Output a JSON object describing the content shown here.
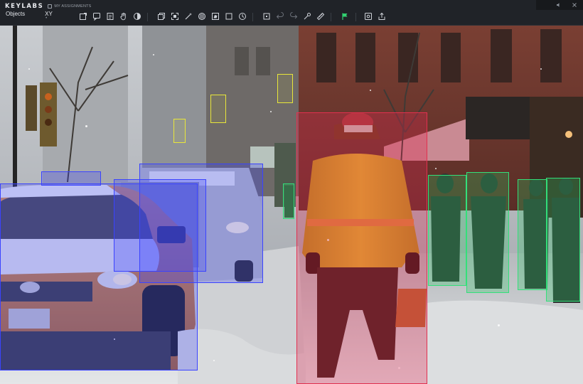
{
  "app": {
    "logo": "KEYLABS",
    "breadcrumb": "MY ASSIGNMENTS"
  },
  "panel_tabs": [
    {
      "label": "Objects"
    },
    {
      "label": "XY"
    }
  ],
  "toolbar": {
    "tools": [
      "frame-icon",
      "comment-icon",
      "document-icon",
      "hand-icon",
      "contrast-icon",
      "copy-layer-icon",
      "expand-icon",
      "magic-icon",
      "pattern-icon",
      "polygon-icon",
      "square-icon",
      "clock-icon",
      "bounding-box-icon",
      "undo-icon",
      "redo-icon",
      "smart-tool-icon",
      "ruler-icon",
      "flag-icon",
      "settings-icon",
      "export-icon"
    ]
  },
  "top_right": {
    "icons": [
      "speaker-icon",
      "close-icon"
    ]
  },
  "annotations": {
    "colors": {
      "car": "#3a43ff",
      "person": "#e2304f",
      "pedestrian": "#33e07a",
      "traffic_light": "#e8e63a"
    }
  }
}
